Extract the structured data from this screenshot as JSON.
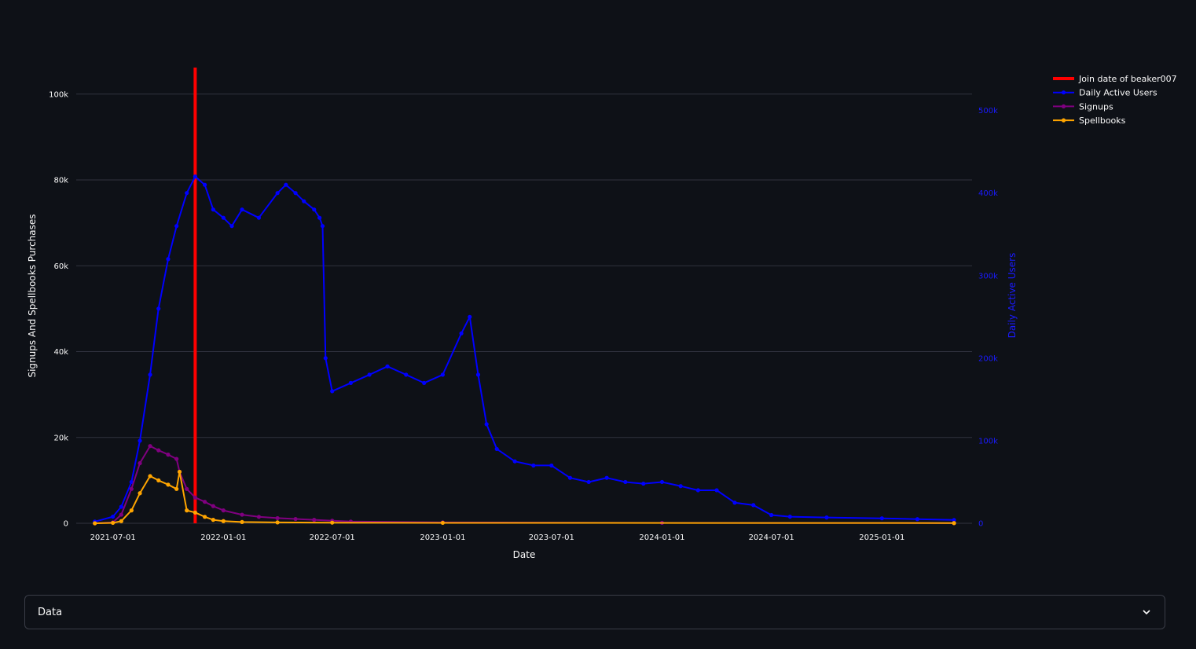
{
  "chart_data": {
    "type": "line",
    "xlabel": "Date",
    "ylabel": "Signups And Spellbooks  Purchases",
    "y2label": "Daily Active Users",
    "x_range": [
      "2021-05-01",
      "2025-05-31"
    ],
    "ylim": [
      0,
      106000
    ],
    "y2lim": [
      0,
      551000
    ],
    "x_ticks": [
      "2021-07-01",
      "2022-01-01",
      "2022-07-01",
      "2023-01-01",
      "2023-07-01",
      "2024-01-01",
      "2024-07-01",
      "2025-01-01"
    ],
    "y_ticks": [
      0,
      20000,
      40000,
      60000,
      80000,
      100000
    ],
    "y_tick_labels": [
      "0",
      "20k",
      "40k",
      "60k",
      "80k",
      "100k"
    ],
    "y2_ticks": [
      0,
      100000,
      200000,
      300000,
      400000,
      500000
    ],
    "y2_tick_labels": [
      "0",
      "100k",
      "200k",
      "300k",
      "400k",
      "500k"
    ],
    "grid": true,
    "legend_position": "top-right",
    "background": "#0e1117",
    "series": [
      {
        "name": "Join date of beaker007",
        "kind": "vline",
        "x": "2021-11-15",
        "color": "#ff0000"
      },
      {
        "name": "Daily Active Users",
        "axis": "y2",
        "color": "#0000ff",
        "x": [
          "2021-06-01",
          "2021-07-01",
          "2021-07-15",
          "2021-08-01",
          "2021-08-15",
          "2021-09-01",
          "2021-09-15",
          "2021-10-01",
          "2021-10-15",
          "2021-11-01",
          "2021-11-15",
          "2021-12-01",
          "2021-12-15",
          "2022-01-01",
          "2022-01-15",
          "2022-02-01",
          "2022-03-01",
          "2022-04-01",
          "2022-04-15",
          "2022-05-01",
          "2022-05-15",
          "2022-06-01",
          "2022-06-10",
          "2022-06-15",
          "2022-06-20",
          "2022-07-01",
          "2022-08-01",
          "2022-09-01",
          "2022-10-01",
          "2022-11-01",
          "2022-12-01",
          "2023-01-01",
          "2023-02-01",
          "2023-02-15",
          "2023-03-01",
          "2023-03-15",
          "2023-04-01",
          "2023-05-01",
          "2023-06-01",
          "2023-07-01",
          "2023-08-01",
          "2023-09-01",
          "2023-10-01",
          "2023-11-01",
          "2023-12-01",
          "2024-01-01",
          "2024-02-01",
          "2024-03-01",
          "2024-04-01",
          "2024-05-01",
          "2024-06-01",
          "2024-07-01",
          "2024-08-01",
          "2024-10-01",
          "2025-01-01",
          "2025-03-01",
          "2025-05-01"
        ],
        "values": [
          2000,
          8000,
          20000,
          50000,
          100000,
          180000,
          260000,
          320000,
          360000,
          400000,
          420000,
          410000,
          380000,
          370000,
          360000,
          380000,
          370000,
          400000,
          410000,
          400000,
          390000,
          380000,
          370000,
          360000,
          200000,
          160000,
          170000,
          180000,
          190000,
          180000,
          170000,
          180000,
          230000,
          250000,
          180000,
          120000,
          90000,
          75000,
          70000,
          70000,
          55000,
          50000,
          55000,
          50000,
          48000,
          50000,
          45000,
          40000,
          40000,
          25000,
          22000,
          10000,
          8000,
          7000,
          6000,
          5000,
          4000
        ]
      },
      {
        "name": "Signups",
        "axis": "y",
        "color": "#800080",
        "x": [
          "2021-06-01",
          "2021-07-01",
          "2021-07-15",
          "2021-08-01",
          "2021-08-15",
          "2021-09-01",
          "2021-09-15",
          "2021-10-01",
          "2021-10-15",
          "2021-10-20",
          "2021-11-01",
          "2021-11-15",
          "2021-12-01",
          "2021-12-15",
          "2022-01-01",
          "2022-02-01",
          "2022-03-01",
          "2022-04-01",
          "2022-05-01",
          "2022-06-01",
          "2022-07-01",
          "2022-08-01",
          "2023-01-01",
          "2024-01-01",
          "2025-05-01"
        ],
        "values": [
          0,
          200,
          2000,
          8000,
          14000,
          18000,
          17000,
          16000,
          15000,
          12000,
          8000,
          6000,
          5000,
          4000,
          3000,
          2000,
          1500,
          1200,
          1000,
          800,
          600,
          400,
          200,
          100,
          50
        ]
      },
      {
        "name": "Spellbooks",
        "axis": "y",
        "color": "#ffa500",
        "x": [
          "2021-06-01",
          "2021-07-01",
          "2021-07-15",
          "2021-08-01",
          "2021-08-15",
          "2021-09-01",
          "2021-09-15",
          "2021-10-01",
          "2021-10-15",
          "2021-10-20",
          "2021-11-01",
          "2021-11-15",
          "2021-12-01",
          "2021-12-15",
          "2022-01-01",
          "2022-02-01",
          "2022-04-01",
          "2022-07-01",
          "2023-01-01",
          "2025-05-01"
        ],
        "values": [
          0,
          100,
          500,
          3000,
          7000,
          11000,
          10000,
          9000,
          8000,
          12000,
          3000,
          2500,
          1500,
          800,
          500,
          300,
          200,
          150,
          100,
          50
        ]
      }
    ]
  },
  "expander": {
    "label": "Data",
    "icon": "chevron-down-icon"
  }
}
